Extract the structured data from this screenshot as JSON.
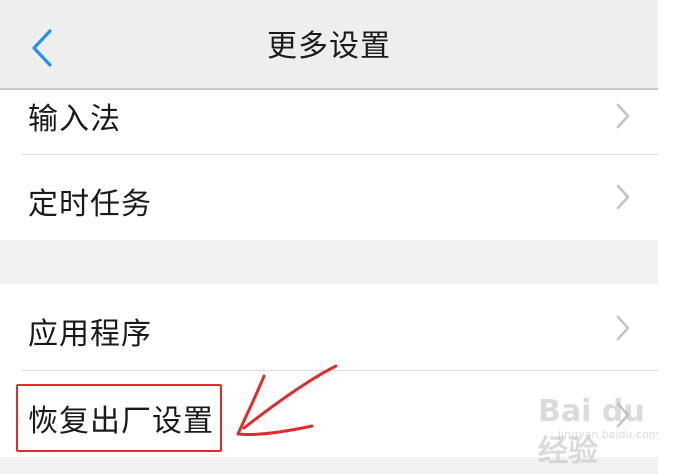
{
  "header": {
    "title": "更多设置"
  },
  "settings": {
    "items": [
      {
        "label": "输入法"
      },
      {
        "label": "定时任务"
      },
      {
        "label": "应用程序"
      },
      {
        "label": "恢复出厂设置"
      }
    ]
  },
  "watermark": {
    "text": "Bai du 经验",
    "url": "jingyan.baidu.com"
  },
  "icons": {
    "back": "chevron-left-icon",
    "row_chevron": "chevron-right-icon",
    "annotation": "red-arrow-annotation"
  },
  "colors": {
    "accent": "#1e90ff",
    "header_bg": "#eeeeee",
    "section_gap": "#f2f2f2",
    "annotation": "#e22b2b",
    "chevron": "#c4c4c4"
  }
}
